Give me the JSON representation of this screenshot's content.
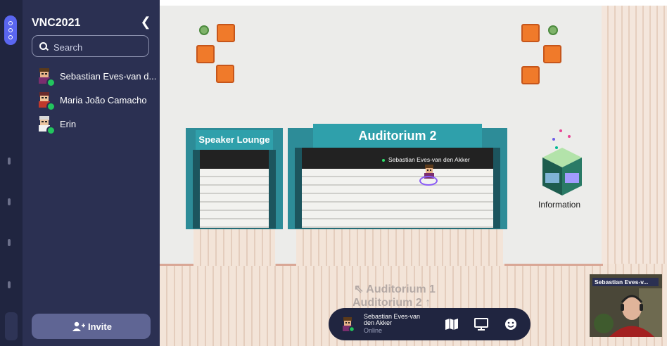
{
  "sidebar": {
    "space_name": "VNC2021",
    "collapse_icon": "chevron-left-icon",
    "search": {
      "placeholder": "Search"
    },
    "members": [
      {
        "name": "Sebastian Eves-van d...",
        "status": "online"
      },
      {
        "name": "Maria João Camacho",
        "status": "online"
      },
      {
        "name": "Erin",
        "status": "online"
      }
    ],
    "invite_label": "Invite",
    "invite_icon": "add-user-icon"
  },
  "map": {
    "rooms": {
      "speaker_lounge": "Speaker Lounge",
      "auditorium_2": "Auditorium 2"
    },
    "player_tag": "Sebastian Eves-van den Akker",
    "information_label": "Information",
    "directions": [
      "⇖ Auditorium 1",
      "Auditorium 2 ↑"
    ]
  },
  "bottom_bar": {
    "user_name": "Sebastian Eves-van den Akker",
    "status": "Online",
    "icons": [
      "map-icon",
      "screen-share-icon",
      "emoji-icon"
    ]
  },
  "video": {
    "name": "Sebastian Eves-v..."
  },
  "colors": {
    "sidebar": "#2b3052",
    "rail": "#202540",
    "online": "#22c55e",
    "teal": "#2d8c98",
    "floor": "#ececea"
  }
}
